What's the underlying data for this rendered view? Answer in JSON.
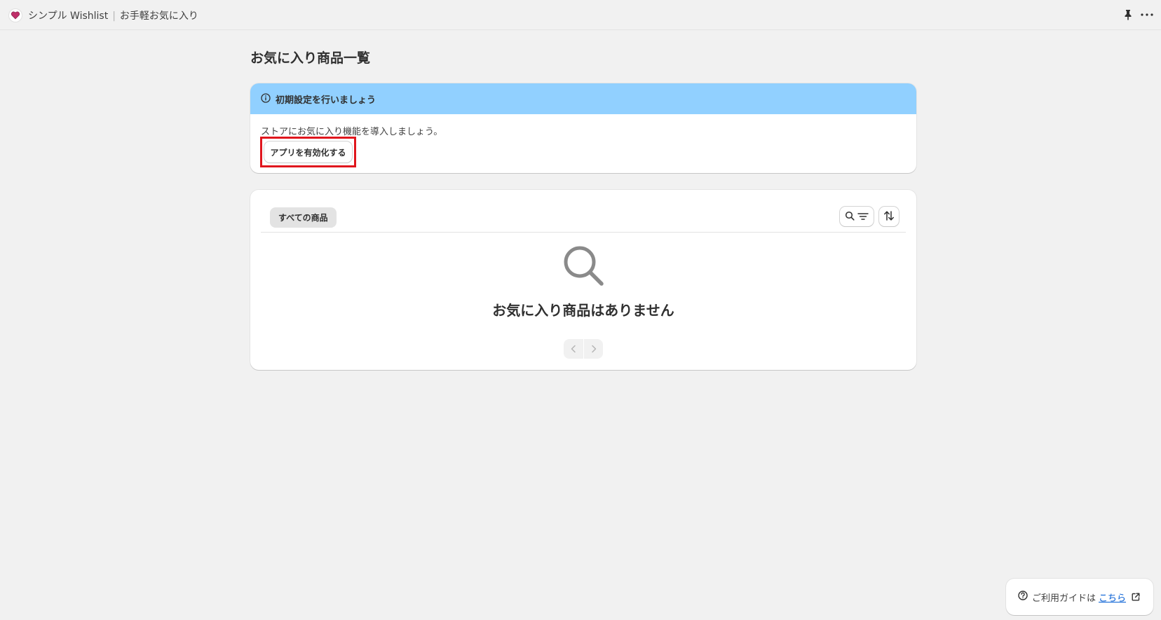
{
  "topbar": {
    "app_name": "シンプル Wishlist",
    "separator": "|",
    "app_subtitle": "お手軽お気に入り",
    "pin_icon": "pin-icon",
    "more_icon": "more-horizontal-icon"
  },
  "page": {
    "title": "お気に入り商品一覧"
  },
  "banner": {
    "icon": "info-icon",
    "title": "初期設定を行いましょう",
    "text": "ストアにお気に入り機能を導入しましょう。",
    "button_label": "アプリを有効化する",
    "head_color": "#91d0ff",
    "highlight_color": "#e0161d"
  },
  "list": {
    "tabs": [
      {
        "label": "すべての商品",
        "selected": true
      }
    ],
    "search_filter_icons": [
      "search-icon",
      "filter-icon"
    ],
    "sort_icon": "sort-icon",
    "empty_icon": "search-icon",
    "empty_title": "お気に入り商品はありません",
    "pager": {
      "prev_icon": "chevron-left-icon",
      "next_icon": "chevron-right-icon",
      "disabled": true
    }
  },
  "help": {
    "icon": "question-circle-icon",
    "text": "ご利用ガイドは",
    "link_text": "こちら",
    "link_color": "#005bd3",
    "external_icon": "external-link-icon"
  }
}
